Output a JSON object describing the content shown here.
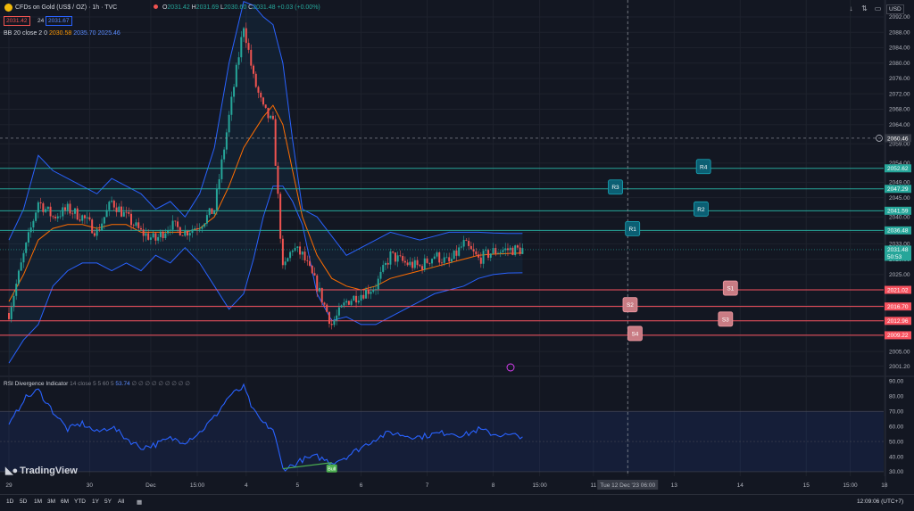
{
  "header": {
    "symbol": "CFDs on Gold (US$ / OZ) · 1h · TVC",
    "open_label": "O",
    "open": "2031.42",
    "high_label": "H",
    "high": "2031.69",
    "low_label": "L",
    "low": "2030.60",
    "close_label": "C",
    "close": "2031.48",
    "change": "+0.03 (+0.00%)",
    "bid": "2031.42",
    "spread": "24",
    "ask": "2031.67",
    "bb_label": "BB 20 close 2 0",
    "bb_basis": "2030.58",
    "bb_upper": "2035.70",
    "bb_lower": "2025.46",
    "currency": "USD"
  },
  "rsi": {
    "label": "RSI Divergence Indicator",
    "params": "14 close 5 5 60 5",
    "value": "53.74",
    "zeros": "∅ ∅ ∅ ∅ ∅ ∅ ∅ ∅ ∅",
    "bull_label": "Bull"
  },
  "brand": "TradingView",
  "timeframes": [
    "1D",
    "5D",
    "1M",
    "3M",
    "6M",
    "YTD",
    "1Y",
    "5Y",
    "All"
  ],
  "clock": "12:09:06 (UTC+7)",
  "crosshair": {
    "price": "2060.46",
    "time": "Tue 12 Dec '23  06:00"
  },
  "current_price": {
    "value": "2031.48",
    "countdown": "50:53"
  },
  "colors": {
    "bg": "#131722",
    "up": "#26a69a",
    "down": "#ef5350",
    "band": "#2962ff",
    "basis": "#ff6d00",
    "resistance": "#26a69a",
    "support": "#f7525f",
    "rsi": "#2962ff"
  },
  "chart_data": [
    {
      "type": "line",
      "title": "CFDs on Gold (US$ / OZ) · 1h · TVC",
      "x_ticks": [
        "29",
        "30",
        "Dec",
        "15:00",
        "4",
        "5",
        "6",
        "7",
        "8",
        "15:00",
        "11",
        "Tue 12 Dec '23  06:00",
        "13",
        "14",
        "15",
        "15:00",
        "18"
      ],
      "y_ticks": [
        "2092.00",
        "2088.00",
        "2084.00",
        "2080.00",
        "2076.00",
        "2072.00",
        "2068.00",
        "2064.00",
        "2059.00",
        "2054.00",
        "2049.00",
        "2045.00",
        "2040.00",
        "2036.00",
        "2033.00",
        "2029.00",
        "2025.00",
        "2021.00",
        "2017.00",
        "2013.00",
        "2009.00",
        "2005.00",
        "2001.20"
      ],
      "ylim": [
        1999,
        2095
      ],
      "price_path": {
        "x_hours": [
          0,
          6,
          12,
          18,
          24,
          30,
          36,
          42,
          48,
          54,
          60,
          66,
          72,
          78,
          84,
          90,
          96,
          100,
          104,
          108,
          112,
          116,
          120,
          126,
          132,
          138,
          144,
          150,
          156,
          162,
          168,
          174,
          180,
          186,
          192,
          198,
          204,
          210
        ],
        "close": [
          2015,
          2030,
          2044,
          2040,
          2042,
          2040,
          2036,
          2044,
          2040,
          2036,
          2034,
          2038,
          2036,
          2038,
          2042,
          2066,
          2090,
          2076,
          2068,
          2064,
          2026,
          2032,
          2030,
          2022,
          2012,
          2018,
          2020,
          2022,
          2030,
          2028,
          2027,
          2030,
          2028,
          2033,
          2029,
          2031,
          2031.5,
          2031.48
        ]
      },
      "series": [
        {
          "name": "BB upper",
          "values": [
            2034,
            2042,
            2056,
            2052,
            2050,
            2048,
            2046,
            2050,
            2048,
            2046,
            2042,
            2044,
            2040,
            2046,
            2058,
            2080,
            2096,
            2095,
            2092,
            2090,
            2080,
            2060,
            2042,
            2040,
            2035,
            2030,
            2032,
            2034,
            2036,
            2035,
            2034,
            2035,
            2036,
            2036,
            2036,
            2035.8,
            2035.7,
            2035.7
          ]
        },
        {
          "name": "BB basis",
          "values": [
            2018,
            2025,
            2034,
            2037,
            2038,
            2038,
            2037,
            2038,
            2038,
            2036,
            2036,
            2036,
            2036,
            2037,
            2040,
            2048,
            2058,
            2062,
            2066,
            2069,
            2064,
            2052,
            2040,
            2030,
            2024,
            2022,
            2021,
            2022,
            2024,
            2025,
            2026,
            2027,
            2028,
            2029,
            2030,
            2030.3,
            2030.5,
            2030.58
          ]
        },
        {
          "name": "BB lower",
          "values": [
            2002,
            2008,
            2012,
            2022,
            2026,
            2028,
            2028,
            2026,
            2028,
            2026,
            2030,
            2028,
            2032,
            2028,
            2022,
            2016,
            2020,
            2029,
            2040,
            2048,
            2048,
            2044,
            2038,
            2020,
            2013,
            2014,
            2012,
            2012,
            2014,
            2016,
            2018,
            2020,
            2021,
            2022,
            2024,
            2025,
            2025.4,
            2025.46
          ]
        }
      ],
      "levels": [
        {
          "label": "R4",
          "value": 2052.62,
          "badge_hour": 284
        },
        {
          "label": "R3",
          "value": 2047.29,
          "badge_hour": 248
        },
        {
          "label": "R2",
          "value": 2041.59,
          "badge_hour": 283
        },
        {
          "label": "R1",
          "value": 2036.48,
          "badge_hour": 255
        },
        {
          "label": "S1",
          "value": 2021.02,
          "badge_hour": 295
        },
        {
          "label": "S2",
          "value": 2016.7,
          "badge_hour": 254
        },
        {
          "label": "S3",
          "value": 2012.96,
          "badge_hour": 293
        },
        {
          "label": "S4",
          "value": 2009.22,
          "badge_hour": 256
        }
      ]
    },
    {
      "type": "line",
      "title": "RSI Divergence Indicator",
      "y_ticks": [
        "90.00",
        "80.00",
        "70.00",
        "60.00",
        "50.00",
        "40.00",
        "30.00"
      ],
      "ylim": [
        27,
        92
      ],
      "zone": [
        30,
        70
      ],
      "series": [
        {
          "name": "RSI",
          "x_hours": [
            0,
            6,
            12,
            18,
            24,
            30,
            36,
            42,
            48,
            54,
            60,
            66,
            72,
            78,
            84,
            90,
            96,
            100,
            104,
            108,
            112,
            116,
            120,
            126,
            132,
            138,
            144,
            150,
            156,
            162,
            168,
            174,
            180,
            186,
            192,
            198,
            204,
            210
          ],
          "values": [
            60,
            78,
            84,
            70,
            58,
            62,
            56,
            60,
            52,
            46,
            48,
            52,
            50,
            56,
            66,
            80,
            86,
            70,
            62,
            58,
            32,
            34,
            38,
            40,
            36,
            40,
            46,
            52,
            56,
            54,
            53,
            55,
            56,
            54,
            58,
            55,
            54,
            53.74
          ]
        }
      ],
      "divergence": {
        "x_hours": [
          112,
          132
        ],
        "values": [
          32,
          36
        ]
      }
    }
  ]
}
